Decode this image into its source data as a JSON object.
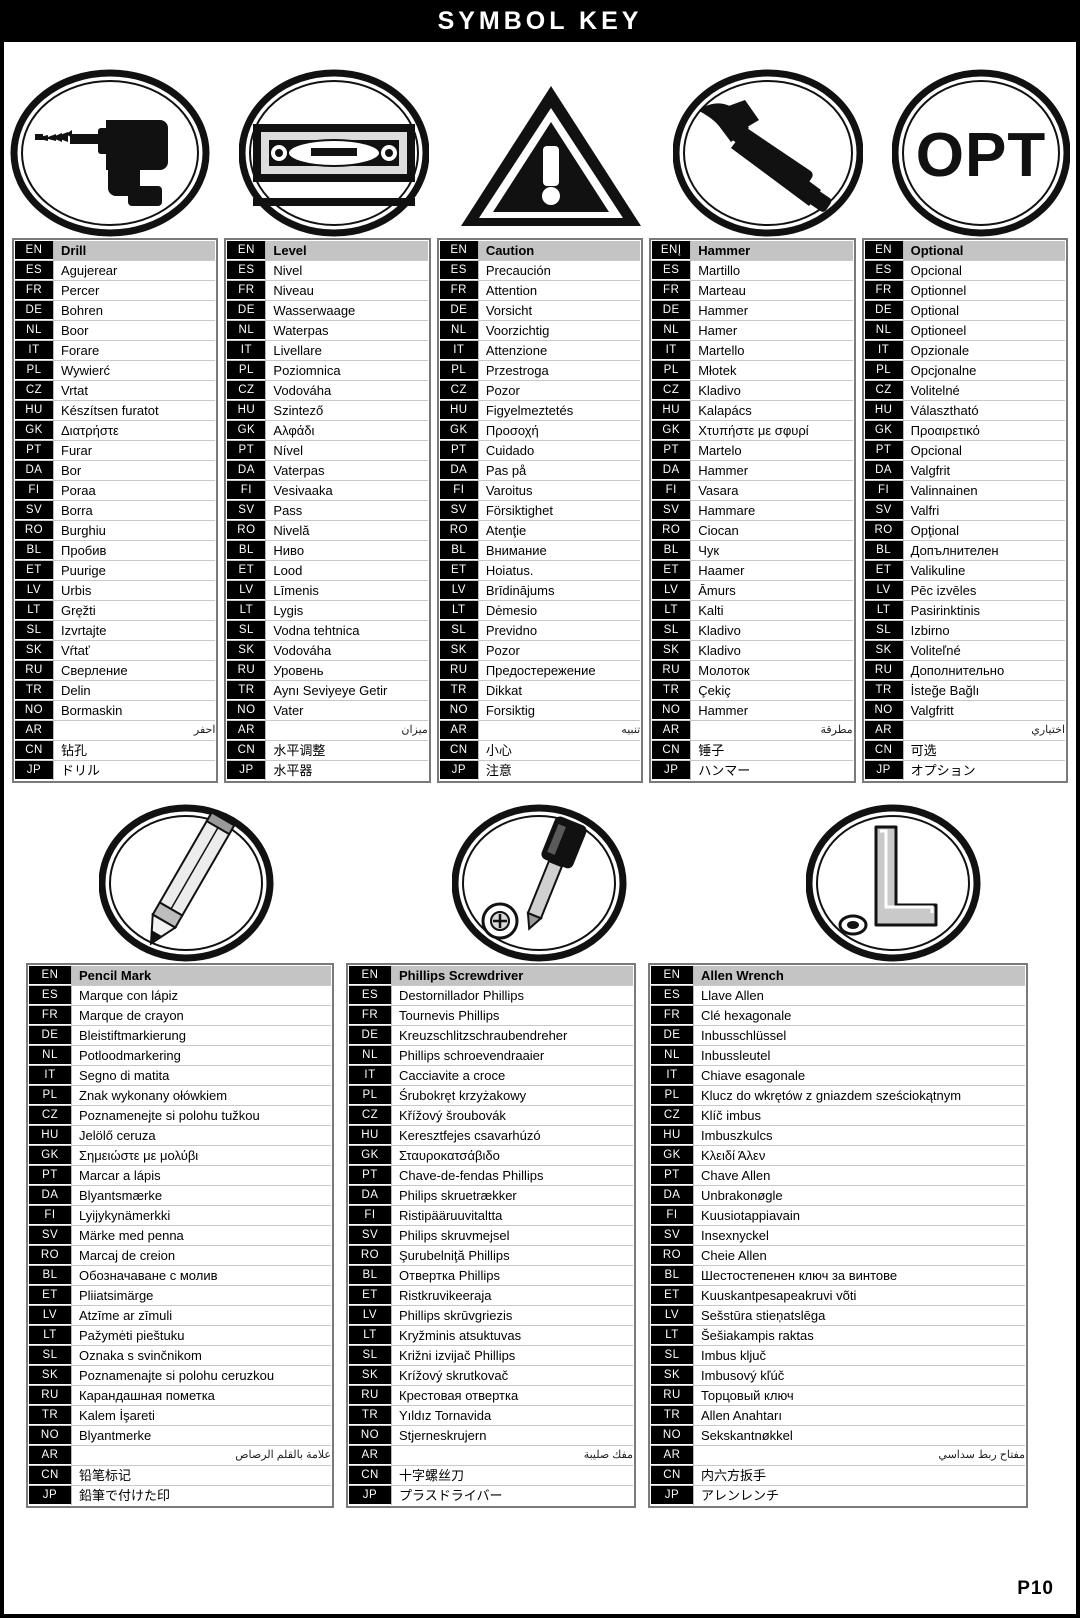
{
  "header": {
    "title": "SYMBOL KEY"
  },
  "footer": {
    "page_label": "P10"
  },
  "symbols_row_1": [
    {
      "name": "drill-symbol",
      "icon": "drill-icon"
    },
    {
      "name": "level-symbol",
      "icon": "level-icon"
    },
    {
      "name": "caution-symbol",
      "icon": "caution-triangle-icon"
    },
    {
      "name": "hammer-symbol",
      "icon": "hammer-icon"
    },
    {
      "name": "optional-symbol",
      "icon": "opt-icon",
      "label": "OPT"
    }
  ],
  "symbols_row_2": [
    {
      "name": "pencil-mark-symbol",
      "icon": "pencil-icon"
    },
    {
      "name": "phillips-screwdriver-symbol",
      "icon": "screwdriver-icon"
    },
    {
      "name": "allen-wrench-symbol",
      "icon": "allen-wrench-icon"
    }
  ],
  "language_codes": [
    "EN",
    "ES",
    "FR",
    "DE",
    "NL",
    "IT",
    "PL",
    "CZ",
    "HU",
    "GK",
    "PT",
    "DA",
    "FI",
    "SV",
    "RO",
    "BL",
    "ET",
    "LV",
    "LT",
    "SL",
    "SK",
    "RU",
    "TR",
    "NO",
    "AR",
    "CN",
    "JP"
  ],
  "tables_row_1": [
    {
      "id": "drill-table",
      "codes": [
        "EN",
        "ES",
        "FR",
        "DE",
        "NL",
        "IT",
        "PL",
        "CZ",
        "HU",
        "GK",
        "PT",
        "DA",
        "FI",
        "SV",
        "RO",
        "BL",
        "ET",
        "LV",
        "LT",
        "SL",
        "SK",
        "RU",
        "TR",
        "NO",
        "AR",
        "CN",
        "JP"
      ],
      "terms": [
        "Drill",
        "Agujerear",
        "Percer",
        "Bohren",
        "Boor",
        "Forare",
        "Wywierć",
        "Vrtat",
        "Készítsen furatot",
        "Διατρήστε",
        "Furar",
        "Bor",
        "Poraa",
        "Borra",
        "Burghiu",
        "Пробив",
        "Puurige",
        "Urbis",
        "Gręžti",
        "Izvrtajte",
        "Vŕtať",
        "Сверление",
        "Delin",
        "Bormaskin",
        "احفر",
        "钻孔",
        "ドリル"
      ]
    },
    {
      "id": "level-table",
      "codes": [
        "EN",
        "ES",
        "FR",
        "DE",
        "NL",
        "IT",
        "PL",
        "CZ",
        "HU",
        "GK",
        "PT",
        "DA",
        "FI",
        "SV",
        "RO",
        "BL",
        "ET",
        "LV",
        "LT",
        "SL",
        "SK",
        "RU",
        "TR",
        "NO",
        "AR",
        "CN",
        "JP"
      ],
      "terms": [
        "Level",
        "Nivel",
        "Niveau",
        "Wasserwaage",
        "Waterpas",
        "Livellare",
        "Poziomnica",
        "Vodováha",
        "Szintező",
        "Αλφάδι",
        "Nível",
        "Vaterpas",
        "Vesivaaka",
        "Pass",
        "Nivelă",
        "Ниво",
        "Lood",
        "Līmenis",
        "Lygis",
        "Vodna tehtnica",
        "Vodováha",
        "Уровень",
        "Aynı Seviyeye Getir",
        "Vater",
        "ميزان",
        "水平调整",
        "水平器"
      ]
    },
    {
      "id": "caution-table",
      "codes": [
        "EN",
        "ES",
        "FR",
        "DE",
        "NL",
        "IT",
        "PL",
        "CZ",
        "HU",
        "GK",
        "PT",
        "DA",
        "FI",
        "SV",
        "RO",
        "BL",
        "ET",
        "LV",
        "LT",
        "SL",
        "SK",
        "RU",
        "TR",
        "NO",
        "AR",
        "CN",
        "JP"
      ],
      "terms": [
        "Caution",
        "Precaución",
        "Attention",
        "Vorsicht",
        "Voorzichtig",
        "Attenzione",
        "Przestroga",
        "Pozor",
        "Figyelmeztetés",
        "Προσοχή",
        "Cuidado",
        "Pas på",
        "Varoitus",
        "Försiktighet",
        "Atenţie",
        "Внимание",
        "Hoiatus.",
        "Brīdinājums",
        "Dėmesio",
        "Previdno",
        "Pozor",
        "Предостережение",
        "Dikkat",
        "Forsiktig",
        "تنبيه",
        "小心",
        "注意"
      ]
    },
    {
      "id": "hammer-table",
      "codes": [
        "ENĮ",
        "ES",
        "FR",
        "DE",
        "NL",
        "IT",
        "PL",
        "CZ",
        "HU",
        "GK",
        "PT",
        "DA",
        "FI",
        "SV",
        "RO",
        "BL",
        "ET",
        "LV",
        "LT",
        "SL",
        "SK",
        "RU",
        "TR",
        "NO",
        "AR",
        "CN",
        "JP"
      ],
      "terms": [
        "Hammer",
        "Martillo",
        "Marteau",
        "Hammer",
        "Hamer",
        "Martello",
        "Młotek",
        "Kladivo",
        "Kalapács",
        "Χτυπήστε με σφυρί",
        "Martelo",
        "Hammer",
        "Vasara",
        "Hammare",
        "Ciocan",
        "Чук",
        "Haamer",
        "Āmurs",
        "Kalti",
        "Kladivo",
        "Kladivo",
        "Молоток",
        "Çekiç",
        "Hammer",
        "مطرقة",
        "锤子",
        "ハンマー"
      ]
    },
    {
      "id": "optional-table",
      "codes": [
        "EN",
        "ES",
        "FR",
        "DE",
        "NL",
        "IT",
        "PL",
        "CZ",
        "HU",
        "GK",
        "PT",
        "DA",
        "FI",
        "SV",
        "RO",
        "BL",
        "ET",
        "LV",
        "LT",
        "SL",
        "SK",
        "RU",
        "TR",
        "NO",
        "AR",
        "CN",
        "JP"
      ],
      "terms": [
        "Optional",
        "Opcional",
        "Optionnel",
        "Optional",
        "Optioneel",
        "Opzionale",
        "Opcjonalne",
        "Volitelné",
        "Választható",
        "Προαιρετικό",
        "Opcional",
        "Valgfrit",
        "Valinnainen",
        "Valfri",
        "Opţional",
        "Допълнителен",
        "Valikuline",
        "Pēc izvēles",
        "Pasirinktinis",
        "Izbirno",
        "Voliteľné",
        "Дополнительно",
        "İsteğe Bağlı",
        "Valgfritt",
        "اختياري",
        "可选",
        "オプション"
      ]
    }
  ],
  "tables_row_2": [
    {
      "id": "pencil-mark-table",
      "codes": [
        "EN",
        "ES",
        "FR",
        "DE",
        "NL",
        "IT",
        "PL",
        "CZ",
        "HU",
        "GK",
        "PT",
        "DA",
        "FI",
        "SV",
        "RO",
        "BL",
        "ET",
        "LV",
        "LT",
        "SL",
        "SK",
        "RU",
        "TR",
        "NO",
        "AR",
        "CN",
        "JP"
      ],
      "terms": [
        "Pencil Mark",
        "Marque con lápiz",
        "Marque de crayon",
        "Bleistiftmarkierung",
        "Potloodmarkering",
        "Segno di matita",
        "Znak wykonany ołówkiem",
        "Poznamenejte si polohu tužkou",
        "Jelölő ceruza",
        "Σημειώστε με μολύβι",
        "Marcar a lápis",
        "Blyantsmærke",
        "Lyijykynämerkki",
        "Märke med penna",
        "Marcaj de creion",
        "Обозначаване с молив",
        "Pliiatsimärge",
        "Atzīme ar zīmuli",
        "Pažymėti pieštuku",
        "Oznaka s svinčnikom",
        "Poznamenajte si polohu ceruzkou",
        "Карандашная пометка",
        "Kalem İşareti",
        "Blyantmerke",
        "علامة بالقلم الرصاص",
        "铅笔标记",
        "鉛筆で付けた印"
      ]
    },
    {
      "id": "phillips-screwdriver-table",
      "codes": [
        "EN",
        "ES",
        "FR",
        "DE",
        "NL",
        "IT",
        "PL",
        "CZ",
        "HU",
        "GK",
        "PT",
        "DA",
        "FI",
        "SV",
        "RO",
        "BL",
        "ET",
        "LV",
        "LT",
        "SL",
        "SK",
        "RU",
        "TR",
        "NO",
        "AR",
        "CN",
        "JP"
      ],
      "terms": [
        "Phillips Screwdriver",
        "Destornillador Phillips",
        "Tournevis Phillips",
        "Kreuzschlitzschraubendreher",
        "Phillips schroevendraaier",
        "Cacciavite a croce",
        "Śrubokręt krzyżakowy",
        "Křížový šroubovák",
        "Keresztfejes csavarhúzó",
        "Σταυροκατσάβιδο",
        "Chave-de-fendas Phillips",
        "Philips skruetrækker",
        "Ristipääruuvitaltta",
        "Philips skruvmejsel",
        "Şurubelniţă Phillips",
        "Отвертка Phillips",
        "Ristkruvikeeraja",
        "Phillips skrūvgriezis",
        "Kryžminis atsuktuvas",
        "Križni izvijač Phillips",
        "Krížový skrutkovač",
        "Крестовая отвертка",
        "Yıldız Tornavida",
        "Stjerneskrujern",
        "مفك صليبة",
        "十字螺丝刀",
        "プラスドライバー"
      ]
    },
    {
      "id": "allen-wrench-table",
      "codes": [
        "EN",
        "ES",
        "FR",
        "DE",
        "NL",
        "IT",
        "PL",
        "CZ",
        "HU",
        "GK",
        "PT",
        "DA",
        "FI",
        "SV",
        "RO",
        "BL",
        "ET",
        "LV",
        "LT",
        "SL",
        "SK",
        "RU",
        "TR",
        "NO",
        "AR",
        "CN",
        "JP"
      ],
      "terms": [
        "Allen Wrench",
        "Llave Allen",
        "Clé hexagonale",
        "Inbusschlüssel",
        "Inbussleutel",
        "Chiave esagonale",
        "Klucz do wkrętów z gniazdem sześciokątnym",
        "Klíč imbus",
        "Imbuszkulcs",
        "Κλειδί Άλεν",
        "Chave Allen",
        "Unbrakonøgle",
        "Kuusiotappiavain",
        "Insexnyckel",
        "Cheie Allen",
        "Шестостепенен ключ за винтове",
        "Kuuskantpesapeakruvi võti",
        "Sešstūra stieņatslēga",
        "Šešiakampis raktas",
        "Imbus ključ",
        "Imbusový kľúč",
        "Торцовый ключ",
        "Allen Anahtarı",
        "Sekskantnøkkel",
        "مفتاح ربط سداسي",
        "内六方扳手",
        "アレンレンチ"
      ]
    }
  ]
}
